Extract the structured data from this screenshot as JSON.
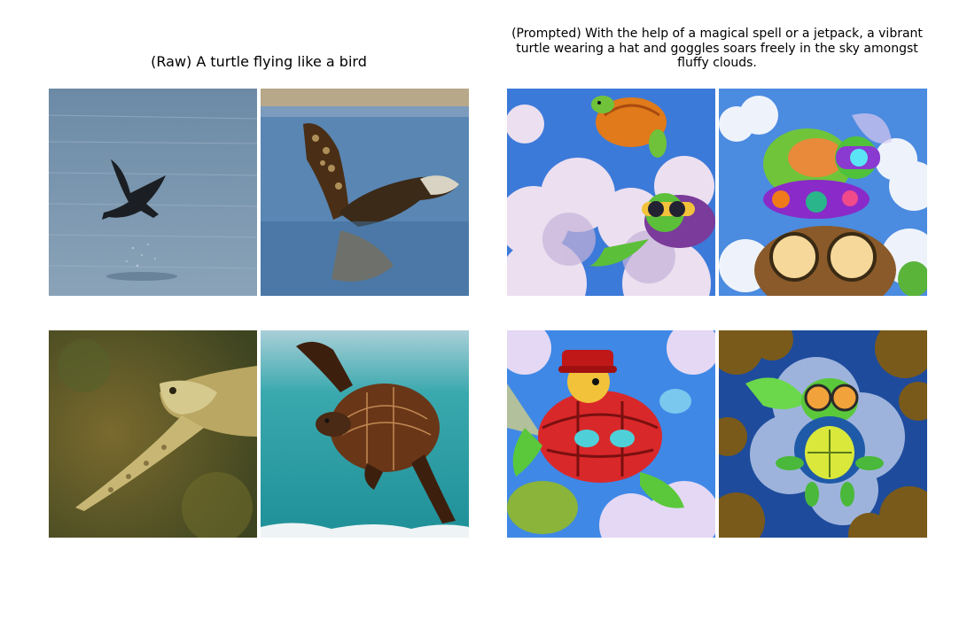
{
  "panels": [
    {
      "title": "(Raw) A turtle flying like a bird",
      "images": [
        {
          "icon": "bird-over-water-photo"
        },
        {
          "icon": "sea-turtle-flipper-raised-photo"
        },
        {
          "icon": "sea-turtle-gliding-photo"
        },
        {
          "icon": "sea-turtle-swimming-ocean-photo"
        }
      ]
    },
    {
      "title": "(Prompted) With the help of a magical spell or a jetpack, a vibrant turtle wearing a hat and goggles soars freely in the sky amongst fluffy clouds.",
      "images": [
        {
          "icon": "cartoon-turtles-in-clouds-illustration"
        },
        {
          "icon": "cartoon-turtle-with-goggles-illustration"
        },
        {
          "icon": "cartoon-turtle-with-red-hat-illustration"
        },
        {
          "icon": "cartoon-turtle-flying-goggles-illustration"
        }
      ]
    }
  ],
  "colors": {
    "sky": "#3c7ad9",
    "water": "#5b7fa0",
    "cloud": "#ecdff0",
    "shell_brown": "#5c3318",
    "turtle_green": "#3aa83a"
  }
}
